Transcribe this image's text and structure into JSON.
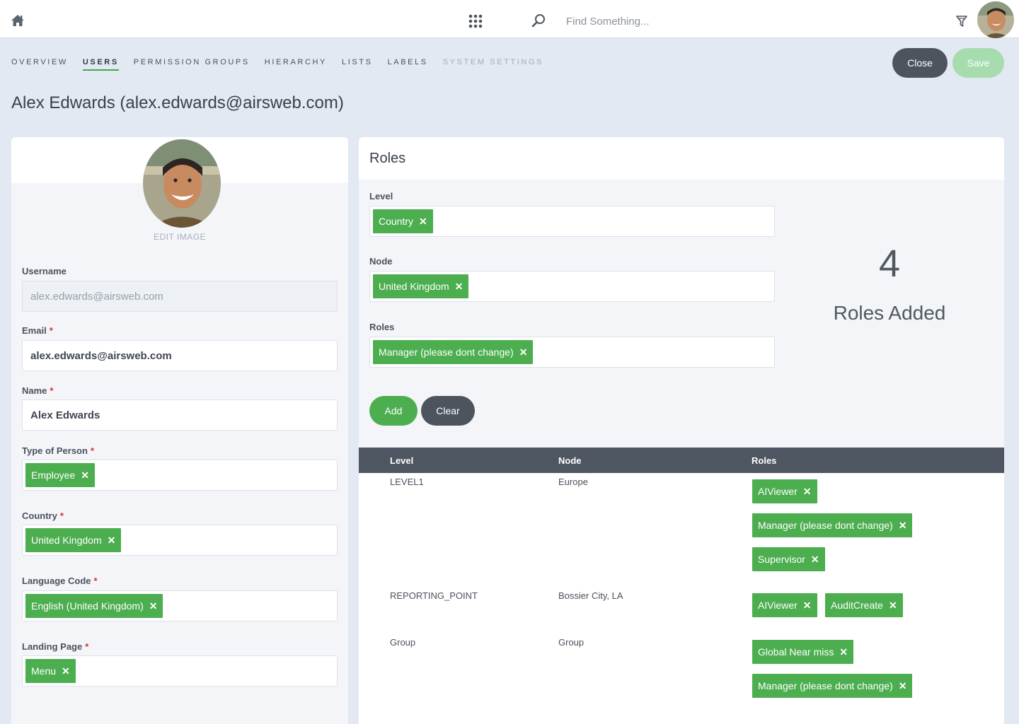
{
  "topbar": {
    "search_placeholder": "Find Something..."
  },
  "nav": {
    "items": [
      {
        "label": "OVERVIEW"
      },
      {
        "label": "USERS"
      },
      {
        "label": "PERMISSION GROUPS"
      },
      {
        "label": "HIERARCHY"
      },
      {
        "label": "LISTS"
      },
      {
        "label": "LABELS"
      },
      {
        "label": "SYSTEM SETTINGS"
      }
    ],
    "active": "USERS"
  },
  "actions": {
    "close_label": "Close",
    "save_label": "Save"
  },
  "page": {
    "title": "Alex Edwards (alex.edwards@airsweb.com)"
  },
  "profile": {
    "edit_image_label": "EDIT IMAGE",
    "fields": {
      "username": {
        "label": "Username",
        "value": "alex.edwards@airsweb.com"
      },
      "email": {
        "label": "Email",
        "value": "alex.edwards@airsweb.com",
        "required": "*"
      },
      "name": {
        "label": "Name",
        "value": "Alex Edwards",
        "required": "*"
      },
      "type_of_person": {
        "label": "Type of Person",
        "tag": "Employee",
        "required": "*"
      },
      "country": {
        "label": "Country",
        "tag": "United Kingdom",
        "required": "*"
      },
      "language_code": {
        "label": "Language Code",
        "tag": "English (United Kingdom)",
        "required": "*"
      },
      "landing_page": {
        "label": "Landing Page",
        "tag": "Menu",
        "required": "*"
      }
    }
  },
  "roles": {
    "title": "Roles",
    "level": {
      "label": "Level",
      "tag": "Country"
    },
    "node": {
      "label": "Node",
      "tag": "United Kingdom"
    },
    "roles_field": {
      "label": "Roles",
      "tag": "Manager (please dont change)"
    },
    "count": "4",
    "count_label": "Roles Added",
    "add_label": "Add",
    "clear_label": "Clear",
    "remove_glyph": "✕",
    "table": {
      "headers": {
        "level": "Level",
        "node": "Node",
        "roles": "Roles"
      },
      "rows": [
        {
          "level": "LEVEL1",
          "node": "Europe",
          "roles": [
            "AIViewer",
            "Manager (please dont change)",
            "Supervisor"
          ]
        },
        {
          "level": "REPORTING_POINT",
          "node": "Bossier City, LA",
          "roles": [
            "AIViewer",
            "AuditCreate"
          ]
        },
        {
          "level": "Group",
          "node": "Group",
          "roles": [
            "Global Near miss",
            "Manager (please dont change)"
          ]
        }
      ]
    }
  },
  "colors": {
    "accent_green": "#4cae4f",
    "dark_button": "#4c545e",
    "save_disabled": "#a6dcae",
    "required": "#d9322f"
  },
  "icons": {
    "home": "home-icon",
    "apps": "grid-icon",
    "search": "search-icon",
    "filter": "filter-icon",
    "remove": "close-icon"
  }
}
